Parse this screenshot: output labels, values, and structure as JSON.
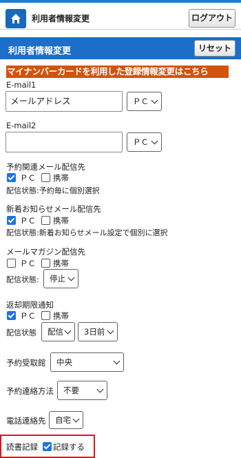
{
  "header": {
    "title": "利用者情報変更",
    "logout_label": "ログアウト"
  },
  "section": {
    "title": "利用者情報変更",
    "reset_label": "リセット"
  },
  "mynumber_link": "マイナンバーカードを利用した登録情報変更はこちら",
  "email1": {
    "label": "E-mail1",
    "value": "メールアドレス",
    "type": "ＰＣ"
  },
  "email2": {
    "label": "E-mail2",
    "value": "",
    "type": "ＰＣ"
  },
  "reservation_mail": {
    "label": "予約関連メール配信先",
    "pc": "ＰＣ",
    "mobile": "携帯",
    "pc_checked": true,
    "mobile_checked": false,
    "status": "配信状態:予約毎に個別選択"
  },
  "new_arrival_mail": {
    "label": "新着お知らせメール配信先",
    "pc": "ＰＣ",
    "mobile": "携帯",
    "pc_checked": true,
    "mobile_checked": false,
    "status": "配信状態:新着お知らせメール設定で個別に選択"
  },
  "magazine": {
    "label": "メールマガジン配信先",
    "pc": "ＰＣ",
    "mobile": "携帯",
    "pc_checked": false,
    "mobile_checked": false,
    "status_label": "配信状態:",
    "status_value": "停止"
  },
  "return_notice": {
    "label": "返却期限通知",
    "pc": "ＰＣ",
    "mobile": "携帯",
    "pc_checked": true,
    "mobile_checked": false,
    "status_label": "配信状態",
    "status_value": "配信",
    "days_value": "3日前"
  },
  "pickup_library": {
    "label": "予約受取館",
    "value": "中央"
  },
  "contact_method": {
    "label": "予約連絡方法",
    "value": "不要"
  },
  "phone_contact": {
    "label": "電話連絡先",
    "value": "自宅"
  },
  "reading_record": {
    "label": "読書記録",
    "checkbox_label": "記録する",
    "checked": true
  }
}
